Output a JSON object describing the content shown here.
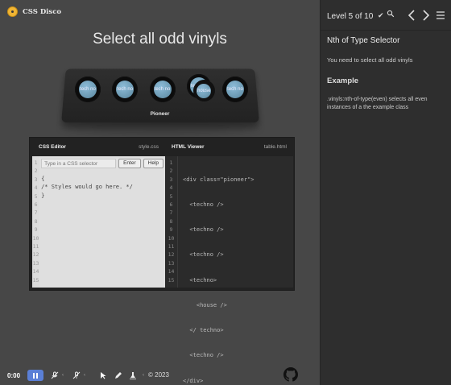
{
  "brand": {
    "name": "CSS Disco",
    "logo_icon": "vinyl-record-icon",
    "accent": "#f0b534"
  },
  "level": {
    "title": "Select all odd vinyls"
  },
  "turntable": {
    "brand": "Pioneer",
    "discs": [
      {
        "label": "tech no"
      },
      {
        "label": "tech no"
      },
      {
        "label": "tech no"
      },
      {
        "label": "tech no",
        "inner_label": "house"
      },
      {
        "label": "tech no"
      }
    ]
  },
  "css_editor": {
    "title": "CSS Editor",
    "filename": "style.css",
    "input_placeholder": "Type in a CSS selector",
    "enter_label": "Enter",
    "help_label": "Help",
    "line_numbers": [
      "1",
      "2",
      "3",
      "4",
      "5",
      "6",
      "7",
      "8",
      "9",
      "10",
      "11",
      "12",
      "13",
      "14",
      "15"
    ],
    "code_lines": [
      "{",
      "/* Styles would go here. */",
      "}"
    ]
  },
  "html_viewer": {
    "title": "HTML Viewer",
    "filename": "table.html",
    "line_numbers": [
      "1",
      "2",
      "3",
      "4",
      "5",
      "6",
      "7",
      "8",
      "9",
      "10",
      "11",
      "12",
      "13",
      "14",
      "15"
    ],
    "code_lines": [
      "<div class=\"pioneer\">",
      "  <techno />",
      "  <techno />",
      "  <techno />",
      "  <techno>",
      "    <house />",
      "  </ techno>",
      "  <techno />",
      "</div>"
    ]
  },
  "bottom_bar": {
    "time": "0:00",
    "copyright": "© 2023",
    "pause_color": "#5a7fd6"
  },
  "sidebar": {
    "level_label": "Level 5 of 10",
    "check_glyph": "✔",
    "title": "Nth of Type Selector",
    "subtitle": "You need to select all odd vinyls",
    "example_heading": "Example",
    "example_text": ".vinyls:nth-of-type(even) selects all even instances of a the example class"
  }
}
